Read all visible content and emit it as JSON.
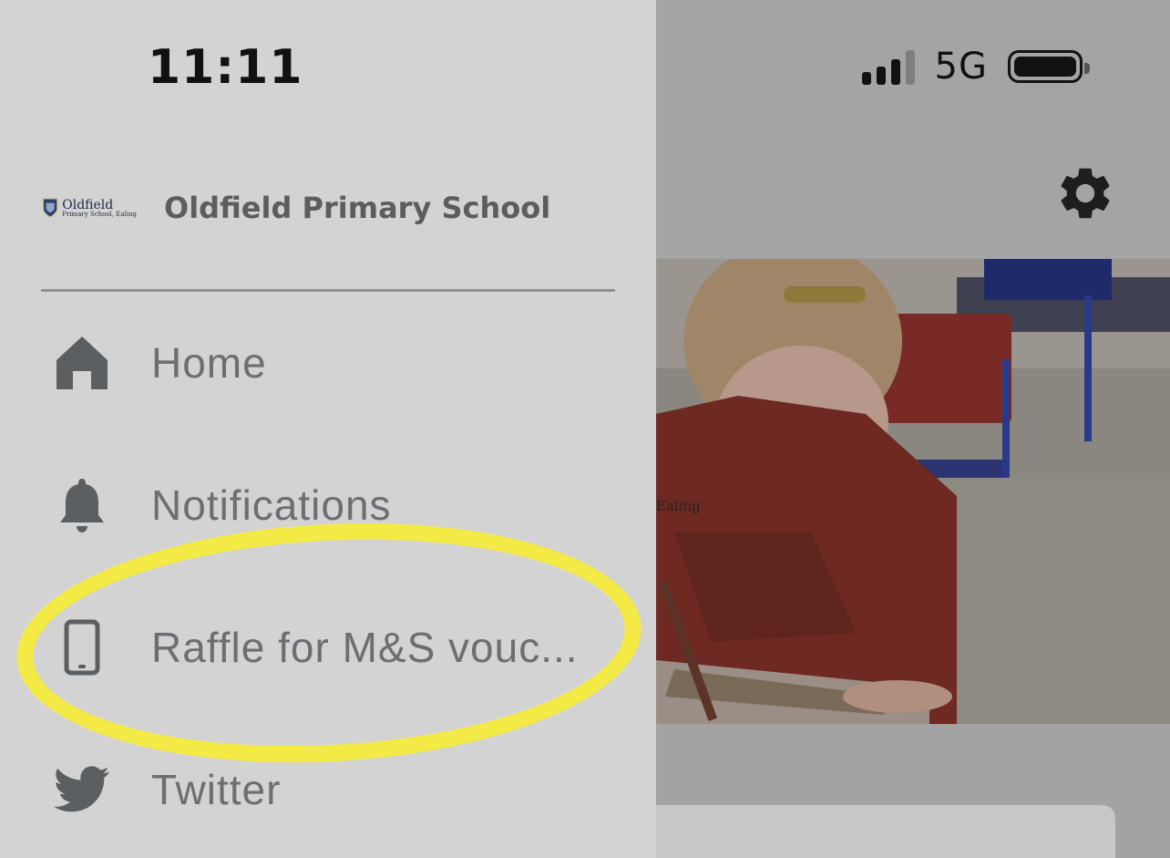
{
  "status_bar": {
    "time": "11:11",
    "network": "5G"
  },
  "drawer": {
    "logo": {
      "name": "Oldfield",
      "subtitle": "Primary School, Ealing"
    },
    "school_name": "Oldfield Primary School",
    "menu_items": [
      {
        "label": "Home",
        "icon": "home-icon"
      },
      {
        "label": "Notifications",
        "icon": "bell-icon"
      },
      {
        "label": "Raffle for M&S vouc...",
        "icon": "phone-icon"
      },
      {
        "label": "Twitter",
        "icon": "twitter-icon"
      }
    ]
  },
  "background_app": {
    "settings_icon": "gear-icon",
    "photo_caption": "Ealing"
  },
  "colors": {
    "drawer_bg": "#d3d3d3",
    "highlight": "#f4ea46",
    "label_color": "#6b6f71"
  }
}
